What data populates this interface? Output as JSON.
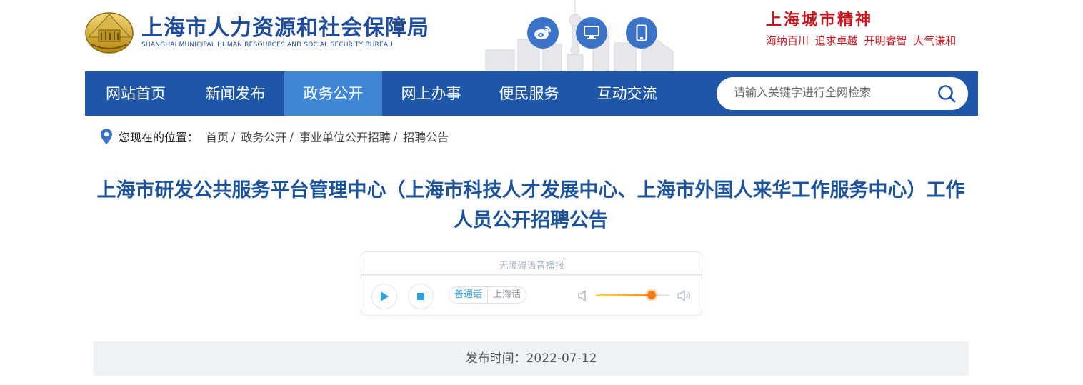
{
  "header": {
    "title": "上海市人力资源和社会保障局",
    "subtitle": "SHANGHAI MUNICIPAL HUMAN RESOURCES AND SOCIAL SECURITY BUREAU",
    "icons": [
      "weibo-icon",
      "desktop-icon",
      "mobile-icon"
    ],
    "spirit_title": "上海城市精神",
    "spirit_values": "海纳百川 追求卓越 开明睿智 大气谦和"
  },
  "nav": {
    "items": [
      {
        "label": "网站首页",
        "active": false
      },
      {
        "label": "新闻发布",
        "active": false
      },
      {
        "label": "政务公开",
        "active": true
      },
      {
        "label": "网上办事",
        "active": false
      },
      {
        "label": "便民服务",
        "active": false
      },
      {
        "label": "互动交流",
        "active": false
      }
    ],
    "search_placeholder": "请输入关键字进行全网检索"
  },
  "breadcrumb": {
    "label": "您现在的位置：",
    "items": [
      "首页",
      "政务公开",
      "事业单位公开招聘",
      "招聘公告"
    ]
  },
  "article": {
    "title": "上海市研发公共服务平台管理中心（上海市科技人才发展中心、上海市外国人来华工作服务中心）工作人员公开招聘公告"
  },
  "player": {
    "title": "无障碍语音播报",
    "languages": [
      {
        "label": "普通话",
        "active": true
      },
      {
        "label": "上海话",
        "active": false
      }
    ],
    "volume": 0.75
  },
  "publish": {
    "label": "发布时间：",
    "date": "2022-07-12"
  },
  "colors": {
    "primary": "#1e56a8",
    "nav_active": "#3f86d6",
    "title_blue": "#1d5399",
    "spirit_red": "#c7161e"
  }
}
